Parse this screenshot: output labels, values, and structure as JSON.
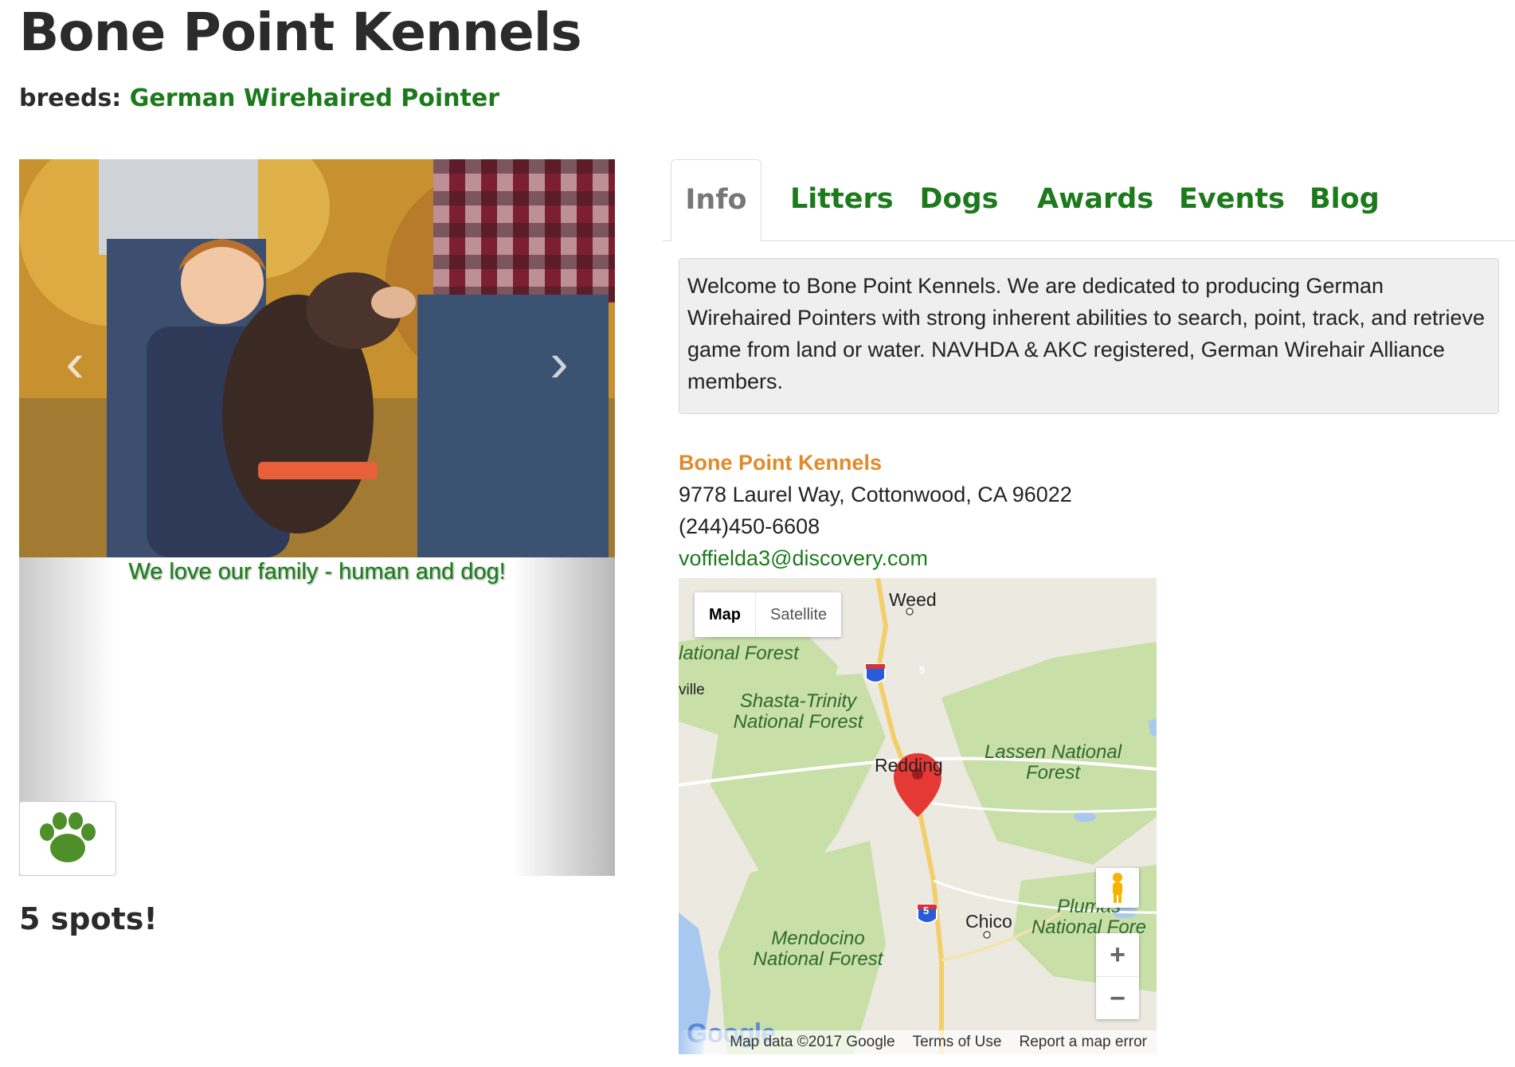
{
  "header": {
    "title": "Bone Point Kennels",
    "breeds_label": "breeds:",
    "breed": "German Wirehaired Pointer"
  },
  "carousel": {
    "caption": "We love our family - human and dog!",
    "prev_icon": "chevron-left-icon",
    "next_icon": "chevron-right-icon",
    "thumbnail_icon": "paw-icon"
  },
  "spots": "5 spots!",
  "tabs": [
    {
      "label": "Info",
      "active": true
    },
    {
      "label": "Litters",
      "active": false
    },
    {
      "label": "Dogs",
      "active": false
    },
    {
      "label": "Awards",
      "active": false
    },
    {
      "label": "Events",
      "active": false
    },
    {
      "label": "Blog",
      "active": false
    }
  ],
  "info": {
    "welcome": "Welcome to Bone Point Kennels. We are dedicated to producing German Wirehaired Pointers with strong inherent abilities to search, point, track, and retrieve game from land or water. NAVHDA & AKC registered, German Wirehair Alliance members."
  },
  "contact": {
    "name": "Bone Point Kennels",
    "address": "9778 Laurel Way, Cottonwood, CA 96022",
    "phone": "(244)450-6608",
    "email": "voffielda3@discovery.com"
  },
  "map": {
    "type_map": "Map",
    "type_satellite": "Satellite",
    "places": {
      "weed": "Weed",
      "ville": "ville",
      "redding": "Redding",
      "chico": "Chico"
    },
    "forests": {
      "national_forest_partial": "lational Forest",
      "shasta": "Shasta-Trinity National Forest",
      "lassen": "Lassen National Forest",
      "mendocino": "Mendocino National Forest",
      "plumas": "Plumas National Fore"
    },
    "interstate": "5",
    "zoom_in": "+",
    "zoom_out": "−",
    "footer": {
      "data": "Map data ©2017 Google",
      "terms": "Terms of Use",
      "report": "Report a map error"
    },
    "logo": "Google",
    "colors": {
      "forest": "#c8dfa8",
      "water": "#a9c8f0",
      "marker": "#e53935"
    }
  },
  "colors": {
    "brand_green": "#1c7a1c",
    "accent_orange": "#e08a2a"
  }
}
